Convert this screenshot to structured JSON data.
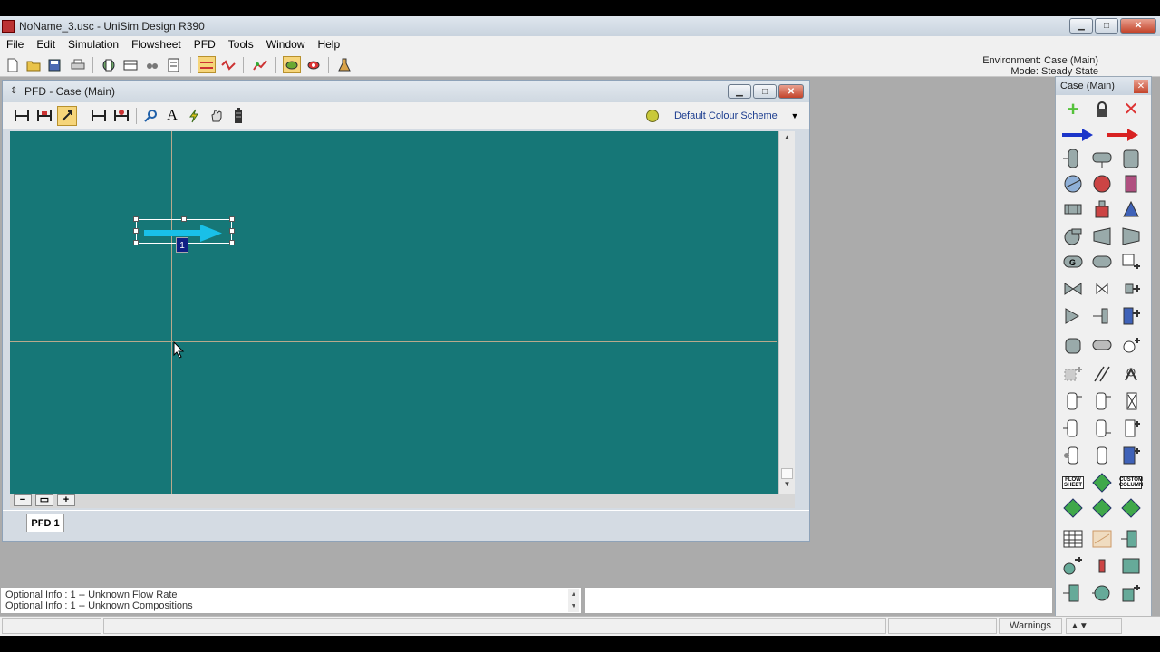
{
  "app": {
    "title": "NoName_3.usc - UniSim Design R390",
    "title_buttons": [
      "▁",
      "□",
      "✕"
    ]
  },
  "menu": [
    "File",
    "Edit",
    "Simulation",
    "Flowsheet",
    "PFD",
    "Tools",
    "Window",
    "Help"
  ],
  "environment": {
    "line1": "Environment: Case (Main)",
    "line2": "Mode: Steady State"
  },
  "pfd_window": {
    "title": "PFD - Case (Main)",
    "colour_scheme": "Default Colour Scheme",
    "zoom_out": "−",
    "zoom_fit": "▭",
    "zoom_in": "+",
    "tab": "PFD 1",
    "stream_label": "1"
  },
  "palette": {
    "title": "Case (Main)",
    "flowsheet_label": "FLOW SHEET",
    "custom_column_label": "CUSTOM COLUMN"
  },
  "info_panel": {
    "line1": "Optional Info  :  1 -- Unknown Flow Rate",
    "line2": "Optional Info  :  1 -- Unknown Compositions"
  },
  "status_bar": {
    "warnings": "Warnings"
  },
  "colors": {
    "canvas": "#167777",
    "stream": "#19c0e8",
    "material_stream": "#1b35c9",
    "energy_stream": "#d82222",
    "add": "#55c23b"
  }
}
